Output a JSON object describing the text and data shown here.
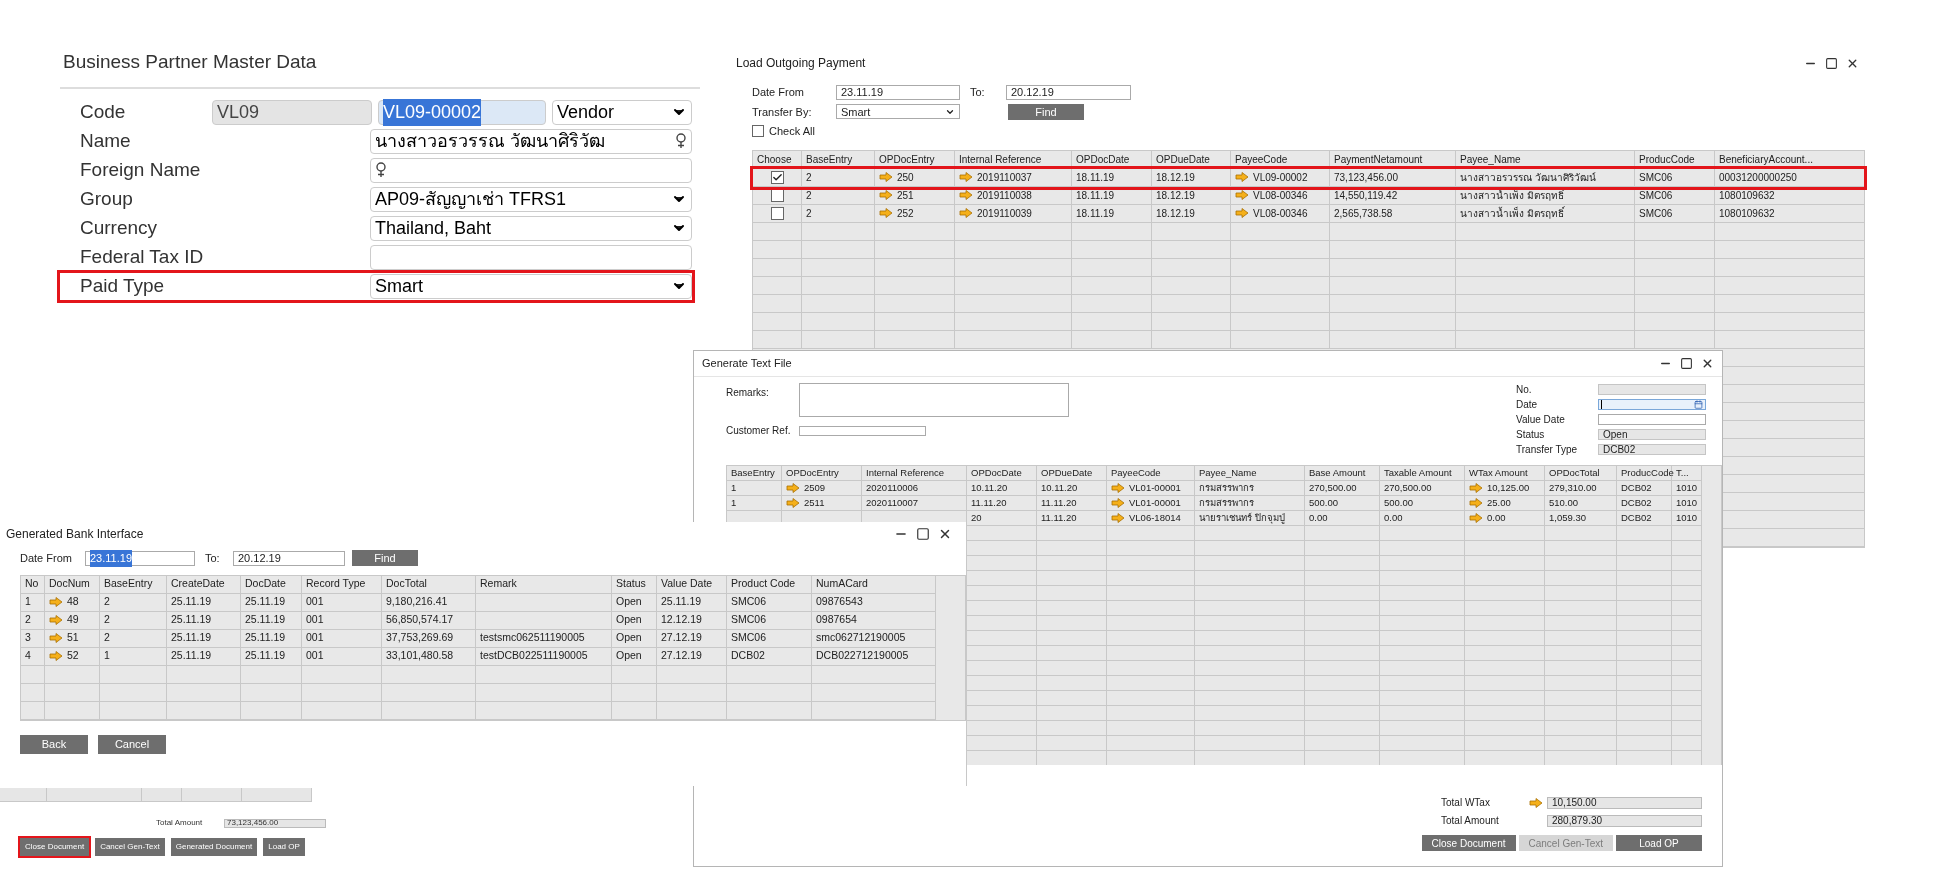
{
  "business_partner": {
    "title": "Business Partner Master Data",
    "fields": [
      {
        "label": "Code",
        "highlighted": false,
        "inputs": [
          {
            "kind": "readonly",
            "value": "VL09"
          },
          {
            "kind": "text",
            "value": "VL09-00002",
            "text_selected": true
          },
          {
            "kind": "dropdown",
            "value": "Vendor"
          }
        ]
      },
      {
        "label": "Name",
        "highlighted": false,
        "inputs": [
          {
            "kind": "lookup",
            "value": "นางสาวอรวรรณ  วัฒนาศิริวัฒ"
          }
        ]
      },
      {
        "label": "Foreign Name",
        "highlighted": false,
        "inputs": [
          {
            "kind": "lookup"
          }
        ]
      },
      {
        "label": "Group",
        "highlighted": false,
        "inputs": [
          {
            "kind": "dropdown",
            "value": "AP09-สัญญาเช่า TFRS1"
          }
        ]
      },
      {
        "label": "Currency",
        "highlighted": false,
        "inputs": [
          {
            "kind": "dropdown",
            "value": "Thailand, Baht"
          }
        ]
      },
      {
        "label": "Federal Tax ID",
        "highlighted": false,
        "inputs": [
          {
            "kind": "text"
          }
        ]
      },
      {
        "label": "Paid Type",
        "highlighted": true,
        "inputs": [
          {
            "kind": "dropdown",
            "value": "Smart"
          }
        ]
      }
    ]
  },
  "load_outgoing_payment": {
    "title": "Load Outgoing Payment",
    "date_from_label": "Date From",
    "date_from": "23.11.19",
    "to_label": "To:",
    "to": "20.12.19",
    "transfer_by_label": "Transfer By:",
    "transfer_by": "Smart",
    "find_button": "Find",
    "check_all": {
      "label": "Check All",
      "checked": false
    },
    "choose_label": "Choose",
    "columns": [
      "BaseEntry",
      "OPDocEntry",
      "Internal Reference",
      "OPDocDate",
      "OPDueDate",
      "PayeeCode",
      "PaymentNetamount",
      "Payee_Name",
      "ProducCode",
      "BeneficiaryAccount..."
    ],
    "rows": [
      {
        "chosen": true,
        "highlighted": true,
        "cells": [
          "2",
          {
            "text": "250",
            "link": true
          },
          {
            "text": "2019110037",
            "link": true
          },
          "18.11.19",
          "18.12.19",
          {
            "text": "VL09-00002",
            "link": true
          },
          "73,123,456.00",
          "นางสาวอรวรรณ  วัฒนาศิริวัฒน์",
          "SMC06",
          "00031200000250"
        ]
      },
      {
        "chosen": false,
        "highlighted": false,
        "cells": [
          "2",
          {
            "text": "251",
            "link": true
          },
          {
            "text": "2019110038",
            "link": true
          },
          "18.11.19",
          "18.12.19",
          {
            "text": "VL08-00346",
            "link": true
          },
          "14,550,119.42",
          "นางสาวน้ำเพ็ง มิตรฤทธิ์",
          "SMC06",
          "1080109632"
        ]
      },
      {
        "chosen": false,
        "highlighted": false,
        "cells": [
          "2",
          {
            "text": "252",
            "link": true
          },
          {
            "text": "2019110039",
            "link": true
          },
          "18.11.19",
          "18.12.19",
          {
            "text": "VL08-00346",
            "link": true
          },
          "2,565,738.58",
          "นางสาวน้ำเพ็ง มิตรฤทธิ์",
          "SMC06",
          "1080109632"
        ]
      }
    ]
  },
  "generate_text_file": {
    "title": "Generate Text File",
    "remarks_label": "Remarks:",
    "customer_ref_label": "Customer Ref.",
    "info_fields": [
      {
        "label": "No.",
        "kind": "readonly"
      },
      {
        "label": "Date",
        "kind": "date",
        "focused": true
      },
      {
        "label": "Value Date",
        "kind": "text"
      },
      {
        "label": "Status",
        "kind": "readonly",
        "value": "Open"
      },
      {
        "label": "Transfer Type",
        "kind": "readonly",
        "value": "DCB02"
      }
    ],
    "columns": [
      "BaseEntry",
      "OPDocEntry",
      "Internal Reference",
      "OPDocDate",
      "OPDueDate",
      "PayeeCode",
      "Payee_Name",
      "Base Amount",
      "Taxable Amount",
      "WTax Amount",
      "OPDocTotal",
      "ProducCode",
      "T..."
    ],
    "rows": [
      {
        "cells": [
          "1",
          {
            "text": "2509",
            "link": true
          },
          "2020110006",
          "10.11.20",
          "10.11.20",
          {
            "text": "VL01-00001",
            "link": true
          },
          "กรมสรรพากร",
          "270,500.00",
          "270,500.00",
          {
            "text": "10,125.00",
            "link": true
          },
          "279,310.00",
          "DCB02",
          "1010"
        ]
      },
      {
        "cells": [
          "1",
          {
            "text": "2511",
            "link": true
          },
          "2020110007",
          "11.11.20",
          "11.11.20",
          {
            "text": "VL01-00001",
            "link": true
          },
          "กรมสรรพากร",
          "500.00",
          "500.00",
          {
            "text": "25.00",
            "link": true
          },
          "510.00",
          "DCB02",
          "1010"
        ]
      },
      {
        "cells": [
          null,
          null,
          null,
          "20",
          "11.11.20",
          {
            "text": "VL06-18014",
            "link": true
          },
          "นายราเชนทร์ ปิกจุมปู่",
          "0.00",
          "0.00",
          {
            "text": "0.00",
            "link": true
          },
          "1,059.30",
          "DCB02",
          "1010"
        ]
      }
    ],
    "total_wtax_label": "Total WTax",
    "total_wtax": "10,150.00",
    "total_amount_label": "Total Amount",
    "total_amount": "280,879.30",
    "buttons": [
      {
        "label": "Close Document",
        "disabled": false
      },
      {
        "label": "Cancel Gen-Text",
        "disabled": true
      },
      {
        "label": "Load OP",
        "disabled": false
      }
    ]
  },
  "generated_bank_interface": {
    "title": "Generated Bank Interface",
    "date_from_label": "Date From",
    "date_from": "23.11.19",
    "date_from_selected": true,
    "to_label": "To:",
    "to": "20.12.19",
    "find_button": "Find",
    "columns": [
      "No",
      "DocNum",
      "BaseEntry",
      "CreateDate",
      "DocDate",
      "Record Type",
      "DocTotal",
      "Remark",
      "Status",
      "Value Date",
      "Product Code",
      "NumACard"
    ],
    "rows": [
      {
        "cells": [
          "1",
          {
            "text": "48",
            "link": true
          },
          "2",
          "25.11.19",
          "25.11.19",
          "001",
          "9,180,216.41",
          null,
          "Open",
          "25.11.19",
          "SMC06",
          "09876543"
        ]
      },
      {
        "cells": [
          "2",
          {
            "text": "49",
            "link": true
          },
          "2",
          "25.11.19",
          "25.11.19",
          "001",
          "56,850,574.17",
          null,
          "Open",
          "12.12.19",
          "SMC06",
          "0987654"
        ]
      },
      {
        "cells": [
          "3",
          {
            "text": "51",
            "link": true
          },
          "2",
          "25.11.19",
          "25.11.19",
          "001",
          "37,753,269.69",
          "testsmc062511190005",
          "Open",
          "27.12.19",
          "SMC06",
          "smc062712190005"
        ]
      },
      {
        "cells": [
          "4",
          {
            "text": "52",
            "link": true
          },
          "1",
          "25.11.19",
          "25.11.19",
          "001",
          "33,101,480.58",
          "testDCB022511190005",
          "Open",
          "27.12.19",
          "DCB02",
          "DCB022712190005"
        ]
      }
    ],
    "buttons": [
      "Back",
      "Cancel"
    ]
  },
  "background_window": {
    "total_amount_label": "Total Amount",
    "total_amount": "73,123,456.00",
    "buttons": [
      {
        "label": "Close Document",
        "highlighted": true
      },
      {
        "label": "Cancel Gen-Text",
        "highlighted": false
      },
      {
        "label": "Generated Document",
        "highlighted": false
      },
      {
        "label": "Load OP",
        "highlighted": false
      }
    ]
  }
}
